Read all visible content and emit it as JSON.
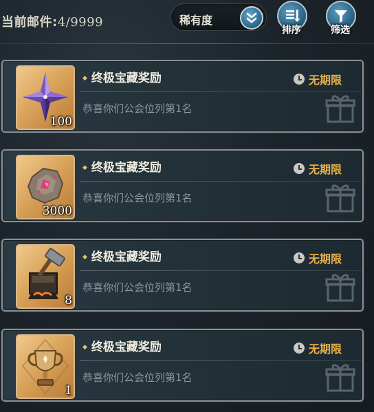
{
  "header": {
    "mail_count_label": "当前邮件:",
    "mail_count_value": "4/9999",
    "sort": {
      "selected": "稀有度"
    },
    "sort_button_label": "排序",
    "filter_button_label": "筛选"
  },
  "mails": [
    {
      "title": "终极宝藏奖励",
      "expiry": "无期限",
      "sender": "恭喜你们公会位列第1名",
      "item": "purple-crystal-icon",
      "quantity": "100"
    },
    {
      "title": "终极宝藏奖励",
      "expiry": "无期限",
      "sender": "恭喜你们公会位列第1名",
      "item": "ore-stone-icon",
      "quantity": "3000"
    },
    {
      "title": "终极宝藏奖励",
      "expiry": "无期限",
      "sender": "恭喜你们公会位列第1名",
      "item": "forge-hammer-icon",
      "quantity": "8"
    },
    {
      "title": "终极宝藏奖励",
      "expiry": "无期限",
      "sender": "恭喜你们公会位列第1名",
      "item": "trophy-icon",
      "quantity": "1"
    }
  ]
}
